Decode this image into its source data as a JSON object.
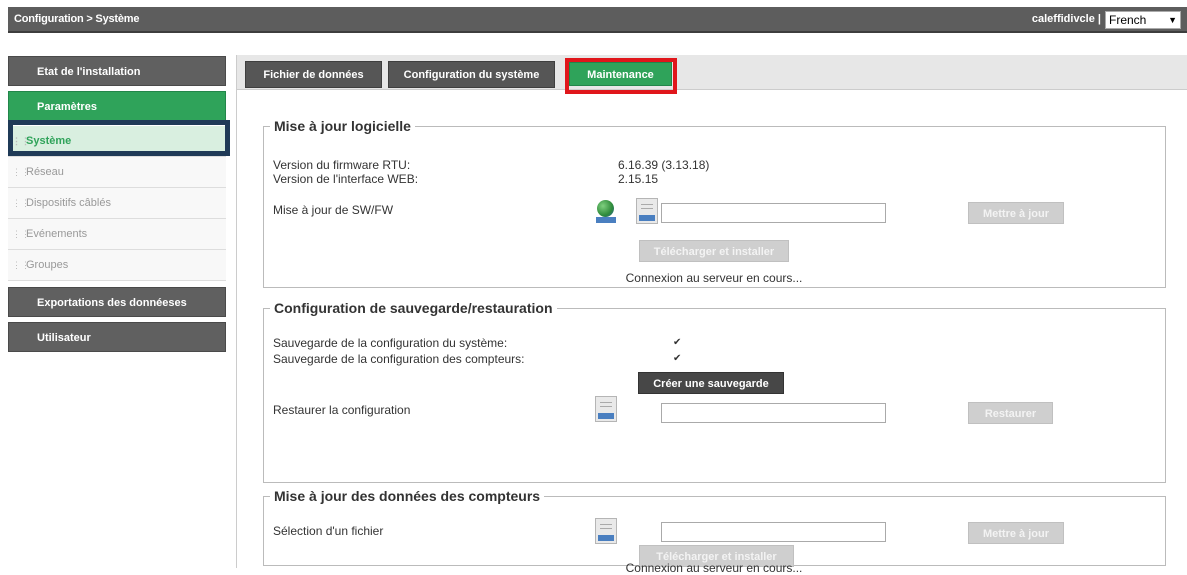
{
  "topbar": {
    "breadcrumb": "Configuration > Système",
    "user": "caleffidivcle |",
    "language": "French"
  },
  "sidebar": {
    "items": [
      {
        "label": "Etat de l'installation",
        "type": "main",
        "active": false
      },
      {
        "label": "Paramètres",
        "type": "main",
        "active": true
      },
      {
        "label": "Système",
        "type": "sub",
        "active": true
      },
      {
        "label": "Réseau",
        "type": "sub",
        "active": false
      },
      {
        "label": "Dispositifs câblés",
        "type": "sub",
        "active": false
      },
      {
        "label": "Evénements",
        "type": "sub",
        "active": false
      },
      {
        "label": "Groupes",
        "type": "sub",
        "active": false
      },
      {
        "label": "Exportations des donnéeses",
        "type": "main",
        "active": false
      },
      {
        "label": "Utilisateur",
        "type": "main",
        "active": false
      }
    ]
  },
  "tabs": [
    {
      "label": "Fichier de données"
    },
    {
      "label": "Configuration du système"
    },
    {
      "label": "Maintenance"
    }
  ],
  "software_update": {
    "legend": "Mise à jour logicielle",
    "fw_label": "Version du firmware RTU:",
    "fw_value": "6.16.39 (3.13.18)",
    "web_label": "Version de l'interface WEB:",
    "web_value": "2.15.15",
    "swfw_label": "Mise à jour de SW/FW",
    "update_button": "Mettre à jour",
    "download_button": "Télécharger et installer",
    "status": "Connexion au serveur en cours..."
  },
  "backup": {
    "legend": "Configuration de sauvegarde/restauration",
    "system_label": "Sauvegarde de la configuration du système:",
    "meters_label": "Sauvegarde de la configuration des compteurs:",
    "create_button": "Créer une sauvegarde",
    "restore_label": "Restaurer la configuration",
    "restore_button": "Restaurer"
  },
  "meter_update": {
    "legend": "Mise à jour des données des compteurs",
    "file_label": "Sélection d'un fichier",
    "update_button": "Mettre à jour",
    "download_button": "Télécharger et installer",
    "status": "Connexion au serveur en cours..."
  },
  "icons": {
    "web": "globe-file-icon",
    "bin": "bin-file-icon",
    "bck": "bck-file-icon"
  },
  "colors": {
    "accent": "#2fa35a",
    "highlight_red": "#e0161b",
    "highlight_navy": "#1f3a57"
  }
}
